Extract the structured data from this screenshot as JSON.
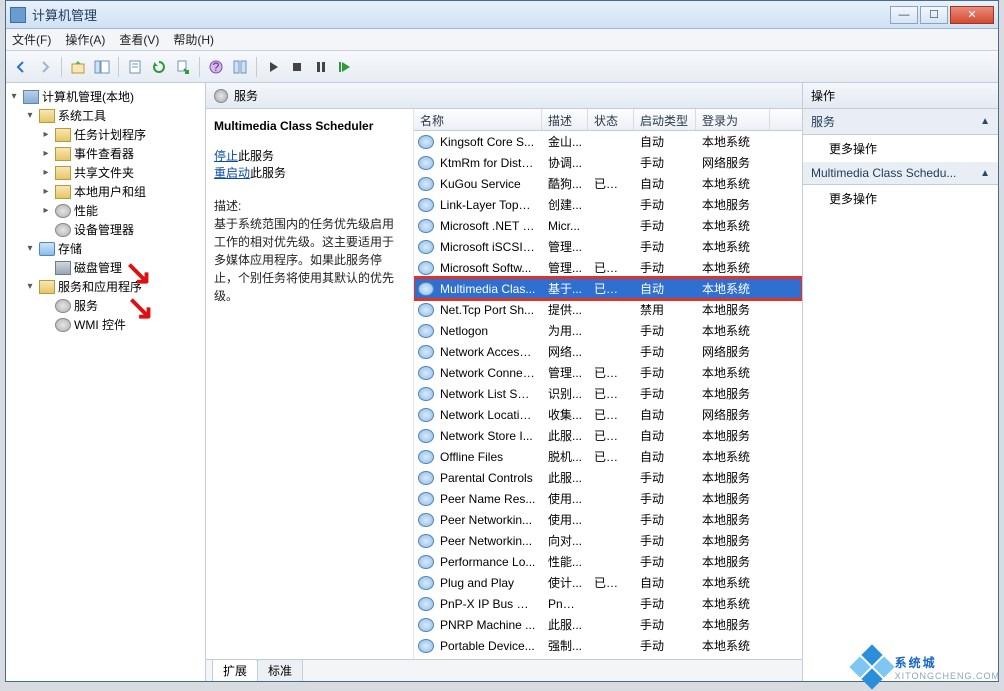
{
  "window": {
    "title": "计算机管理"
  },
  "menu": [
    "文件(F)",
    "操作(A)",
    "查看(V)",
    "帮助(H)"
  ],
  "tree_root": "计算机管理(本地)",
  "tree": [
    {
      "label": "系统工具",
      "depth": 2,
      "twisty": "▾",
      "icon": "ic-fold"
    },
    {
      "label": "任务计划程序",
      "depth": 3,
      "twisty": "▸",
      "icon": "ic-fold"
    },
    {
      "label": "事件查看器",
      "depth": 3,
      "twisty": "▸",
      "icon": "ic-fold"
    },
    {
      "label": "共享文件夹",
      "depth": 3,
      "twisty": "▸",
      "icon": "ic-fold"
    },
    {
      "label": "本地用户和组",
      "depth": 3,
      "twisty": "▸",
      "icon": "ic-fold"
    },
    {
      "label": "性能",
      "depth": 3,
      "twisty": "▸",
      "icon": "ic-gear"
    },
    {
      "label": "设备管理器",
      "depth": 3,
      "twisty": "",
      "icon": "ic-gear"
    },
    {
      "label": "存储",
      "depth": 2,
      "twisty": "▾",
      "icon": "ic-db"
    },
    {
      "label": "磁盘管理",
      "depth": 3,
      "twisty": "",
      "icon": "ic-disk"
    },
    {
      "label": "服务和应用程序",
      "depth": 2,
      "twisty": "▾",
      "icon": "ic-fold"
    },
    {
      "label": "服务",
      "depth": 3,
      "twisty": "",
      "icon": "ic-gear"
    },
    {
      "label": "WMI 控件",
      "depth": 3,
      "twisty": "",
      "icon": "ic-gear"
    }
  ],
  "mid_title": "服务",
  "detail": {
    "heading": "Multimedia Class Scheduler",
    "link_stop": "停止",
    "link_stop_tail": "此服务",
    "link_restart": "重启动",
    "link_restart_tail": "此服务",
    "desc_label": "描述:",
    "desc": "基于系统范围内的任务优先级启用工作的相对优先级。这主要适用于多媒体应用程序。如果此服务停止，个别任务将使用其默认的优先级。"
  },
  "columns": [
    "名称",
    "描述",
    "状态",
    "启动类型",
    "登录为"
  ],
  "services": [
    {
      "name": "Kingsoft Core S...",
      "desc": "金山...",
      "stat": "",
      "start": "自动",
      "logon": "本地系统"
    },
    {
      "name": "KtmRm for Distri...",
      "desc": "协调...",
      "stat": "",
      "start": "手动",
      "logon": "网络服务"
    },
    {
      "name": "KuGou Service",
      "desc": "酷狗...",
      "stat": "已启动",
      "start": "自动",
      "logon": "本地系统"
    },
    {
      "name": "Link-Layer Topol...",
      "desc": "创建...",
      "stat": "",
      "start": "手动",
      "logon": "本地服务"
    },
    {
      "name": "Microsoft .NET F...",
      "desc": "Micr...",
      "stat": "",
      "start": "手动",
      "logon": "本地系统"
    },
    {
      "name": "Microsoft iSCSI I...",
      "desc": "管理...",
      "stat": "",
      "start": "手动",
      "logon": "本地系统"
    },
    {
      "name": "Microsoft Softw...",
      "desc": "管理...",
      "stat": "已启动",
      "start": "手动",
      "logon": "本地系统"
    },
    {
      "name": "Multimedia Clas...",
      "desc": "基于...",
      "stat": "已启动",
      "start": "自动",
      "logon": "本地系统",
      "selected": true
    },
    {
      "name": "Net.Tcp Port Sh...",
      "desc": "提供...",
      "stat": "",
      "start": "禁用",
      "logon": "本地服务"
    },
    {
      "name": "Netlogon",
      "desc": "为用...",
      "stat": "",
      "start": "手动",
      "logon": "本地系统"
    },
    {
      "name": "Network Access ...",
      "desc": "网络...",
      "stat": "",
      "start": "手动",
      "logon": "网络服务"
    },
    {
      "name": "Network Connec...",
      "desc": "管理...",
      "stat": "已启动",
      "start": "手动",
      "logon": "本地系统"
    },
    {
      "name": "Network List Ser...",
      "desc": "识别...",
      "stat": "已启动",
      "start": "手动",
      "logon": "本地服务"
    },
    {
      "name": "Network Locatio...",
      "desc": "收集...",
      "stat": "已启动",
      "start": "自动",
      "logon": "网络服务"
    },
    {
      "name": "Network Store I...",
      "desc": "此服...",
      "stat": "已启动",
      "start": "自动",
      "logon": "本地服务"
    },
    {
      "name": "Offline Files",
      "desc": "脱机...",
      "stat": "已启动",
      "start": "自动",
      "logon": "本地系统"
    },
    {
      "name": "Parental Controls",
      "desc": "此服...",
      "stat": "",
      "start": "手动",
      "logon": "本地服务"
    },
    {
      "name": "Peer Name Res...",
      "desc": "使用...",
      "stat": "",
      "start": "手动",
      "logon": "本地服务"
    },
    {
      "name": "Peer Networkin...",
      "desc": "使用...",
      "stat": "",
      "start": "手动",
      "logon": "本地服务"
    },
    {
      "name": "Peer Networkin...",
      "desc": "向对...",
      "stat": "",
      "start": "手动",
      "logon": "本地服务"
    },
    {
      "name": "Performance Lo...",
      "desc": "性能...",
      "stat": "",
      "start": "手动",
      "logon": "本地服务"
    },
    {
      "name": "Plug and Play",
      "desc": "使计...",
      "stat": "已启动",
      "start": "自动",
      "logon": "本地系统"
    },
    {
      "name": "PnP-X IP Bus En...",
      "desc": "PnP-...",
      "stat": "",
      "start": "手动",
      "logon": "本地系统"
    },
    {
      "name": "PNRP Machine ...",
      "desc": "此服...",
      "stat": "",
      "start": "手动",
      "logon": "本地服务"
    },
    {
      "name": "Portable Device...",
      "desc": "强制...",
      "stat": "",
      "start": "手动",
      "logon": "本地系统"
    }
  ],
  "tabs": [
    "扩展",
    "标准"
  ],
  "actions": {
    "title": "操作",
    "group1": "服务",
    "item1": "更多操作",
    "group2": "Multimedia Class Schedu...",
    "item2": "更多操作"
  },
  "watermark": {
    "big": "系统城",
    "small": "XITONGCHENG.COM"
  }
}
